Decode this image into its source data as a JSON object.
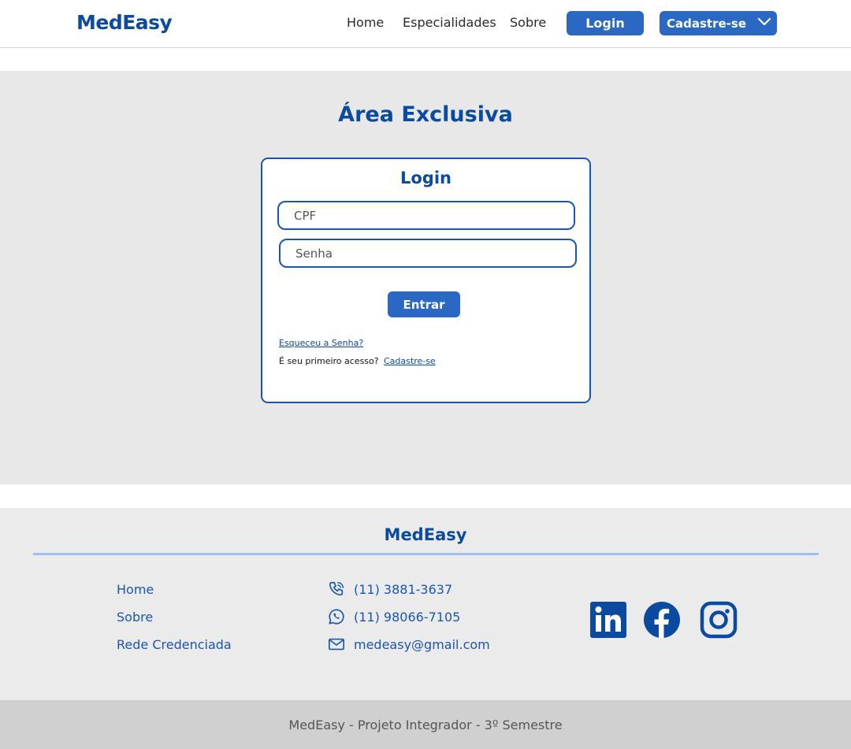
{
  "header": {
    "logo": "MedEasy",
    "nav": [
      "Home",
      "Especialidades",
      "Sobre"
    ],
    "login_label": "Login",
    "cadastre_label": "Cadastre-se"
  },
  "main": {
    "title": "Área Exclusiva",
    "card": {
      "title": "Login",
      "cpf_placeholder": "CPF",
      "senha_placeholder": "Senha",
      "entrar_label": "Entrar",
      "forgot_label": "Esqueceu a Senha?",
      "first_access_text": "É seu primeiro acesso?",
      "register_link": "Cadastre-se"
    }
  },
  "footer": {
    "logo": "MedEasy",
    "links": [
      "Home",
      "Sobre",
      "Rede Credenciada"
    ],
    "contacts": [
      {
        "icon": "phone-icon",
        "text": "(11) 3881-3637"
      },
      {
        "icon": "whatsapp-icon",
        "text": "(11) 98066-7105"
      },
      {
        "icon": "mail-icon",
        "text": "medeasy@gmail.com"
      }
    ],
    "social": [
      "linkedin-icon",
      "facebook-icon",
      "instagram-icon"
    ],
    "bottom_text": "MedEasy - Projeto Integrador - 3º Semestre"
  },
  "colors": {
    "brand": "#0a4aa0",
    "button": "#2a68c4",
    "panel": "#e8e8e9",
    "divider": "#9dbdf0"
  }
}
